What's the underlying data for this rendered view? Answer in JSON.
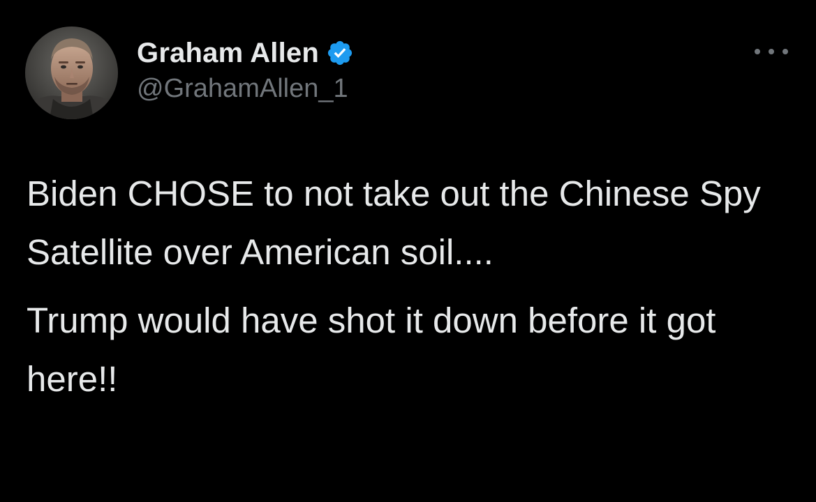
{
  "author": {
    "display_name": "Graham Allen",
    "handle": "@GrahamAllen_1",
    "verified": true,
    "verified_color": "#1d9bf0"
  },
  "menu": {
    "icon": "more-horizontal-icon"
  },
  "tweet": {
    "paragraphs": [
      "Biden CHOSE to not take out the Chinese Spy Satellite over American soil....",
      "Trump would have shot it down before it got here!!"
    ]
  },
  "theme": {
    "background": "#000000",
    "text_primary": "#e7e9ea",
    "text_secondary": "#71767b"
  }
}
